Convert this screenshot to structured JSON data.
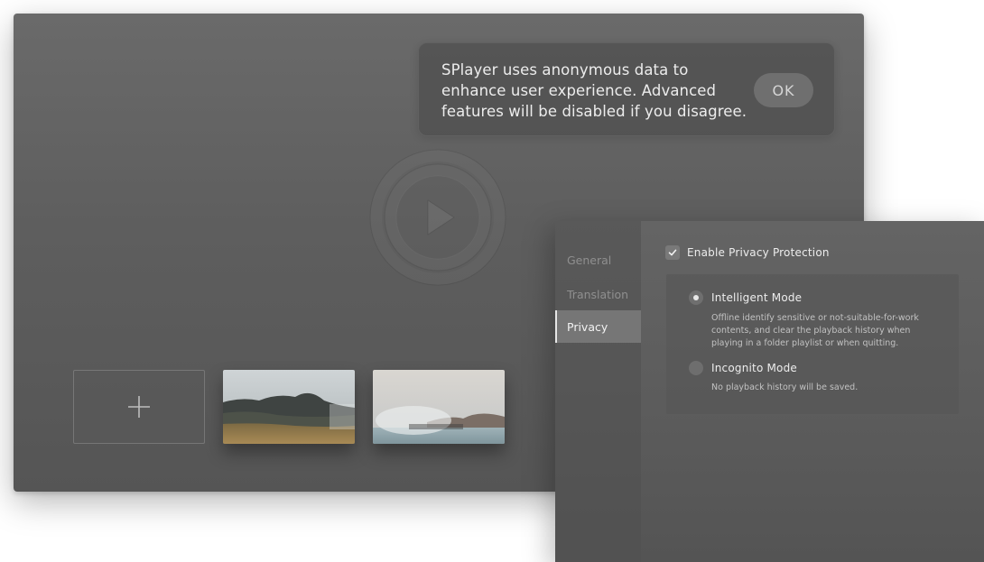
{
  "notice": {
    "message": "SPlayer uses anonymous data to enhance user experience. Advanced features will be disabled if you disagree.",
    "ok_label": "OK"
  },
  "player": {
    "logo_icon": "play-circle-icon",
    "add_icon": "plus-icon",
    "recent_items": [
      {
        "thumbnail": "mountain-landscape"
      },
      {
        "thumbnail": "misty-lake-landscape"
      }
    ]
  },
  "preferences": {
    "tabs": [
      {
        "label": "General",
        "active": false
      },
      {
        "label": "Translation",
        "active": false
      },
      {
        "label": "Privacy",
        "active": true
      }
    ],
    "privacy": {
      "enable_label": "Enable Privacy Protection",
      "enabled": true,
      "modes": [
        {
          "label": "Intelligent Mode",
          "selected": true,
          "description": "Offline identify sensitive or not-suitable-for-work contents, and clear the playback history when playing in a folder playlist or when quitting."
        },
        {
          "label": "Incognito Mode",
          "selected": false,
          "description": "No playback history will be saved."
        }
      ]
    }
  },
  "colors": {
    "window_bg": "#5e5e5e",
    "panel_bg": "#5b5b5b",
    "text_primary": "#ececec",
    "text_muted": "#8f8f8f"
  }
}
